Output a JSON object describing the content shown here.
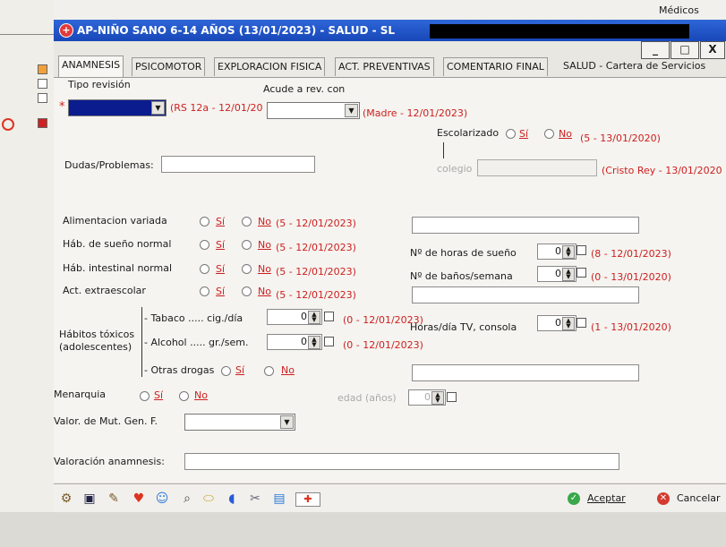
{
  "window": {
    "title": "AP-NIÑO SANO 6-14 AÑOS (13/01/2023) - SALUD - SL",
    "corner_label": "Médicos",
    "controls": [
      "_",
      "□",
      "X"
    ]
  },
  "tabs": [
    {
      "label": "ANAMNESIS",
      "active": true
    },
    {
      "label": "PSICOMOTOR"
    },
    {
      "label": "EXPLORACION FISICA"
    },
    {
      "label": "ACT. PREVENTIVAS"
    },
    {
      "label": "COMENTARIO FINAL"
    },
    {
      "label": "SALUD - Cartera de Servicios"
    }
  ],
  "form": {
    "tipo_revision": {
      "label": "Tipo revisión",
      "required_mark": "*",
      "value": "",
      "note": "(RS 12a - 12/01/20"
    },
    "acude": {
      "label": "Acude a rev. con",
      "value": "",
      "note": "(Madre - 12/01/2023)"
    },
    "escolarizado": {
      "label": "Escolarizado",
      "si": "Sí",
      "no": "No",
      "note": "(5 - 13/01/2020)"
    },
    "colegio": {
      "label": "colegio",
      "value": "",
      "note": "(Cristo Rey - 13/01/2020"
    },
    "dudas": {
      "label": "Dudas/Problemas:",
      "value": ""
    },
    "rows": [
      {
        "label": "Alimentacion variada",
        "si": "Sí",
        "no": "No",
        "note": "(5 - 12/01/2023)"
      },
      {
        "label": "Háb. de sueño normal",
        "si": "Sí",
        "no": "No",
        "note": "(5 - 12/01/2023)"
      },
      {
        "label": "Háb. intestinal normal",
        "si": "Sí",
        "no": "No",
        "note": "(5 - 12/01/2023)"
      },
      {
        "label": "Act. extraescolar",
        "si": "Sí",
        "no": "No",
        "note": "(5 - 12/01/2023)"
      }
    ],
    "horas_sueno": {
      "label": "Nº de horas de sueño",
      "value": "0",
      "note": "(8 - 12/01/2023)"
    },
    "banos": {
      "label": "Nº de baños/semana",
      "value": "0",
      "note": "(0 - 13/01/2020)"
    },
    "habitos": {
      "label_line1": "Hábitos tóxicos",
      "label_line2": "(adolescentes)",
      "tabaco": {
        "label": "- Tabaco ..... cig./día",
        "value": "0",
        "note": "(0 - 12/01/2023)"
      },
      "alcohol": {
        "label": "- Alcohol ..... gr./sem.",
        "value": "0",
        "note": "(0 - 12/01/2023)"
      },
      "otras": {
        "label": "- Otras drogas",
        "si": "Sí",
        "no": "No"
      }
    },
    "tv": {
      "label": "Horas/día TV, consola",
      "value": "0",
      "note": "(1 - 13/01/2020)"
    },
    "menarquia": {
      "label": "Menarquia",
      "si": "Sí",
      "no": "No"
    },
    "edad": {
      "label": "edad (años)",
      "value": "0"
    },
    "valor_mut": {
      "label": "Valor. de Mut. Gen. F.",
      "value": ""
    },
    "valoracion": {
      "label": "Valoración anamnesis:",
      "value": ""
    }
  },
  "toolbar": {
    "icons": [
      "tools-icon",
      "monitor-icon",
      "pencil-icon",
      "heart-icon",
      "user-search-icon",
      "magnifier-icon",
      "pill-icon",
      "patient-icon",
      "syringe-icon",
      "document-icon",
      "first-aid-icon"
    ],
    "accept_label": "Aceptar",
    "cancel_label": "Cancelar"
  },
  "colors": {
    "title_bar": "#1f52c4",
    "history_note": "#cc1f1f",
    "selected_field": "#0b1c8e"
  }
}
